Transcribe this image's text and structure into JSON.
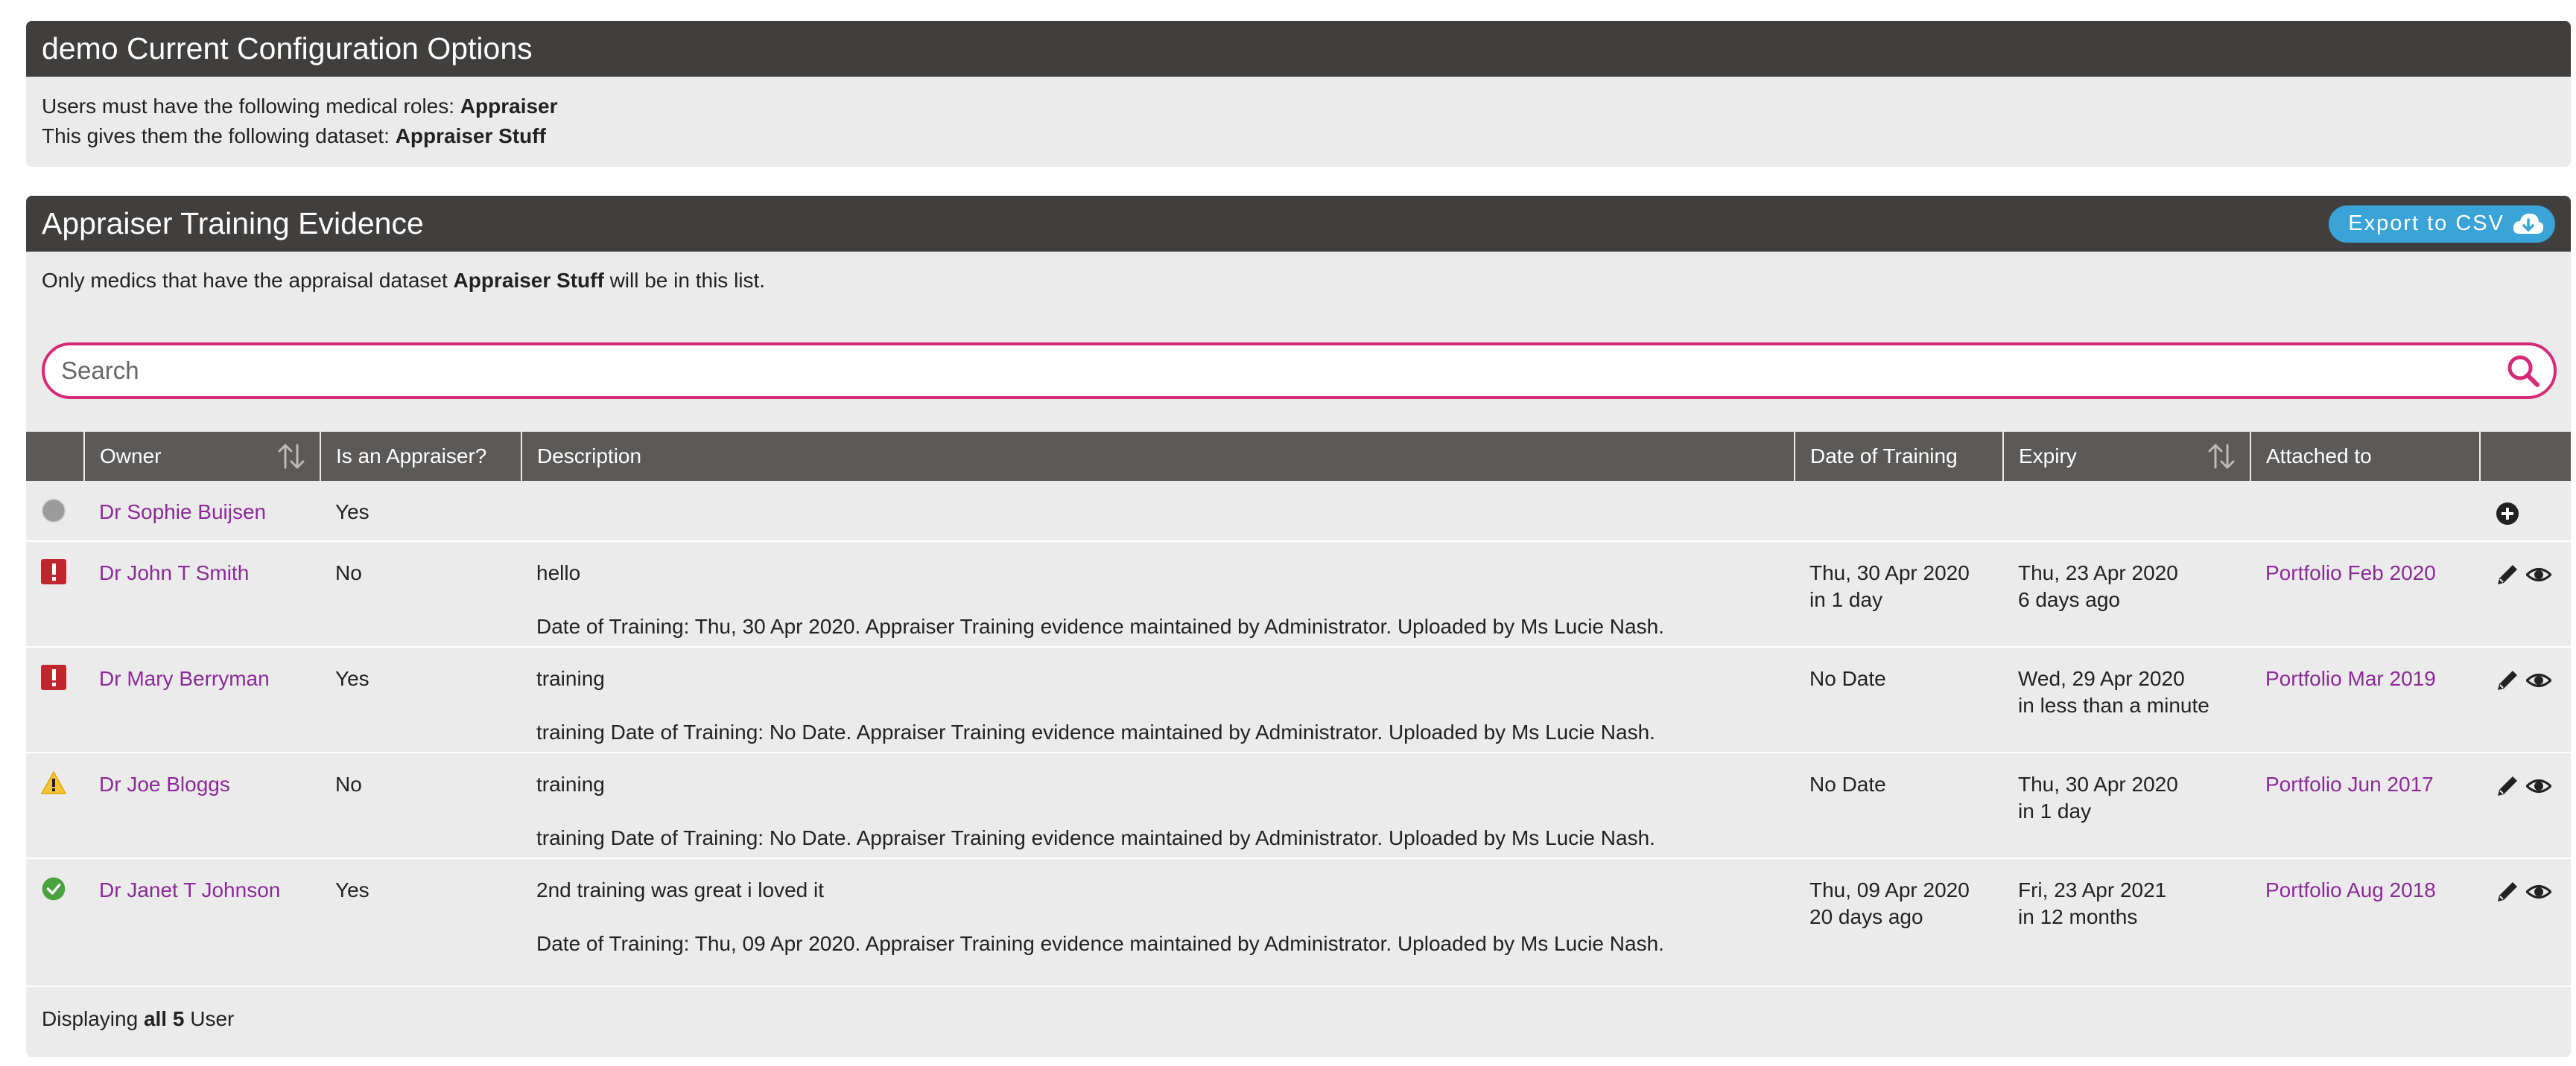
{
  "config": {
    "title": "demo Current Configuration Options",
    "line1_prefix": "Users must have the following medical roles: ",
    "line1_value": "Appraiser",
    "line2_prefix": "This gives them the following dataset: ",
    "line2_value": "Appraiser Stuff"
  },
  "evidence": {
    "title": "Appraiser Training Evidence",
    "export_label": "Export to CSV",
    "intro_prefix": "Only medics that have the appraisal dataset ",
    "intro_value": "Appraiser Stuff",
    "intro_suffix": " will be in this list.",
    "search_placeholder": "Search",
    "columns": {
      "owner": "Owner",
      "appraiser": "Is an Appraiser?",
      "description": "Description",
      "date": "Date of Training",
      "expiry": "Expiry",
      "attached": "Attached to"
    },
    "rows": [
      {
        "status_icon": "grey-circle-icon",
        "owner": "Dr Sophie Buijsen",
        "appraiser": "Yes",
        "desc_title": "",
        "desc_detail": "",
        "date": "",
        "date_rel": "",
        "expiry": "",
        "expiry_rel": "",
        "attached": ""
      },
      {
        "status_icon": "error-icon",
        "owner": "Dr John T Smith",
        "appraiser": "No",
        "desc_title": "hello",
        "desc_detail": "Date of Training: Thu, 30 Apr 2020. Appraiser Training evidence maintained by Administrator. Uploaded by Ms Lucie Nash.",
        "date": "Thu, 30 Apr 2020",
        "date_rel": "in 1 day",
        "expiry": "Thu, 23 Apr 2020",
        "expiry_rel": "6 days ago",
        "attached": "Portfolio Feb 2020"
      },
      {
        "status_icon": "error-icon",
        "owner": "Dr Mary Berryman",
        "appraiser": "Yes",
        "desc_title": "training",
        "desc_detail": "training Date of Training: No Date. Appraiser Training evidence maintained by Administrator. Uploaded by Ms Lucie Nash.",
        "date": "No Date",
        "date_rel": "",
        "expiry": "Wed, 29 Apr 2020",
        "expiry_rel": "in less than a minute",
        "attached": "Portfolio Mar 2019"
      },
      {
        "status_icon": "warning-icon",
        "owner": "Dr Joe Bloggs",
        "appraiser": "No",
        "desc_title": "training",
        "desc_detail": "training Date of Training: No Date. Appraiser Training evidence maintained by Administrator. Uploaded by Ms Lucie Nash.",
        "date": "No Date",
        "date_rel": "",
        "expiry": "Thu, 30 Apr 2020",
        "expiry_rel": "in 1 day",
        "attached": "Portfolio Jun 2017"
      },
      {
        "status_icon": "check-circle-icon",
        "owner": "Dr Janet T Johnson",
        "appraiser": "Yes",
        "desc_title": "2nd training was great i loved it",
        "desc_detail": "Date of Training: Thu, 09 Apr 2020. Appraiser Training evidence maintained by Administrator. Uploaded by Ms Lucie Nash.",
        "date": "Thu, 09 Apr 2020",
        "date_rel": "20 days ago",
        "expiry": "Fri, 23 Apr 2021",
        "expiry_rel": "in 12 months",
        "attached": "Portfolio Aug 2018"
      }
    ],
    "footer_prefix": "Displaying ",
    "footer_value": "all 5",
    "footer_suffix": " User"
  },
  "colors": {
    "header_bg": "#403f3e",
    "table_header_bg": "#5c5a58",
    "link": "#8b2a98",
    "search_border": "#d62b78",
    "export_bg": "#3aa3d8"
  }
}
